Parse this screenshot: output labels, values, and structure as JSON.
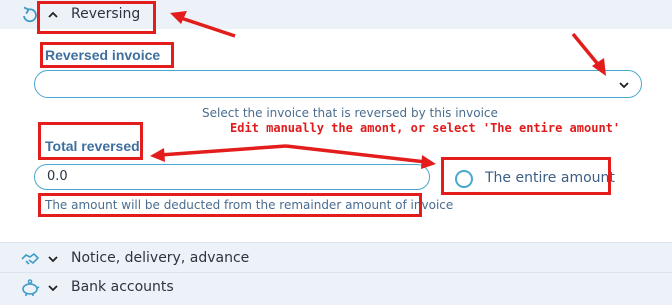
{
  "sections": {
    "reversing": {
      "label": "Reversing",
      "icon": "reverse-arrow-icon",
      "expanded": true
    },
    "notice": {
      "label": "Notice, delivery, advance",
      "icon": "handshake-icon",
      "expanded": false
    },
    "bank": {
      "label": "Bank accounts",
      "icon": "piggy-bank-icon",
      "expanded": false
    }
  },
  "reversed_invoice": {
    "label": "Reversed invoice",
    "value": "",
    "help": "Select the invoice that is reversed by this invoice"
  },
  "total_reversed": {
    "label": "Total reversed",
    "value": "0.0",
    "help": "The amount will be deducted from the remainder amount of invoice"
  },
  "entire_amount": {
    "label": "The entire amount",
    "checked": false
  },
  "annotation": {
    "text": "Edit manually the amont, or select 'The entire amount'"
  },
  "colors": {
    "accent": "#4aa8cf",
    "annotation": "#e31c1c",
    "label": "#3e6f9e",
    "header_bg": "#ecf2f7"
  }
}
